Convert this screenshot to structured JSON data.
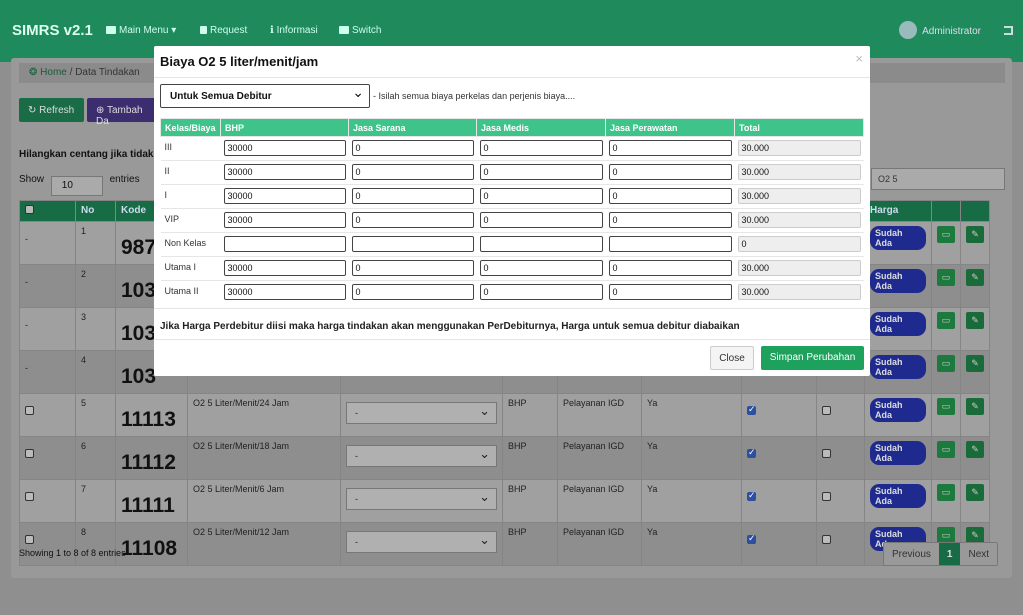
{
  "app": {
    "brand": "SIMRS v2.1",
    "nav": [
      {
        "label": "Main Menu ▾",
        "icon": "folder-icon"
      },
      {
        "label": "Request",
        "icon": "file-icon"
      },
      {
        "label": "Informasi",
        "icon": "info-icon"
      },
      {
        "label": "Switch",
        "icon": "users-icon"
      }
    ],
    "user": "Administrator"
  },
  "breadcrumb": {
    "home": "Home",
    "current": "Data Tindakan"
  },
  "toolbar": {
    "refresh": "Refresh",
    "add": "Tambah Da"
  },
  "hint": "Hilangkan centang jika tidak a",
  "show": {
    "prefix": "Show",
    "value": "10",
    "suffix": "entries"
  },
  "search_value": "O2 5",
  "table": {
    "headers": [
      "",
      "No",
      "Kode",
      "",
      "",
      "",
      "",
      "",
      "",
      "",
      "Harga",
      "",
      ""
    ],
    "rows": [
      {
        "cb": "-",
        "no": "1",
        "code": "987",
        "name": "",
        "dd": "",
        "type": "",
        "unit": "",
        "ya": "",
        "c1": null,
        "c2": null,
        "status": "Sudah Ada"
      },
      {
        "cb": "-",
        "no": "2",
        "code": "103",
        "name": "",
        "dd": "",
        "type": "",
        "unit": "",
        "ya": "",
        "c1": null,
        "c2": null,
        "status": "Sudah Ada"
      },
      {
        "cb": "-",
        "no": "3",
        "code": "103",
        "name": "",
        "dd": "",
        "type": "",
        "unit": "",
        "ya": "",
        "c1": null,
        "c2": null,
        "status": "Sudah Ada"
      },
      {
        "cb": "-",
        "no": "4",
        "code": "103",
        "name": "",
        "dd": "",
        "type": "",
        "unit": "",
        "ya": "",
        "c1": null,
        "c2": null,
        "status": "Sudah Ada"
      },
      {
        "cb": "box",
        "no": "5",
        "code": "11113",
        "name": "O2 5 Liter/Menit/24 Jam",
        "dd": "-",
        "type": "BHP",
        "unit": "Pelayanan IGD",
        "ya": "Ya",
        "c1": true,
        "c2": false,
        "status": "Sudah Ada"
      },
      {
        "cb": "box",
        "no": "6",
        "code": "11112",
        "name": "O2 5 Liter/Menit/18 Jam",
        "dd": "-",
        "type": "BHP",
        "unit": "Pelayanan IGD",
        "ya": "Ya",
        "c1": true,
        "c2": false,
        "status": "Sudah Ada"
      },
      {
        "cb": "box",
        "no": "7",
        "code": "11111",
        "name": "O2 5 Liter/Menit/6 Jam",
        "dd": "-",
        "type": "BHP",
        "unit": "Pelayanan IGD",
        "ya": "Ya",
        "c1": true,
        "c2": false,
        "status": "Sudah Ada"
      },
      {
        "cb": "box",
        "no": "8",
        "code": "11108",
        "name": "O2 5 Liter/Menit/12 Jam",
        "dd": "-",
        "type": "BHP",
        "unit": "Pelayanan IGD",
        "ya": "Ya",
        "c1": true,
        "c2": false,
        "status": "Sudah Ada"
      }
    ]
  },
  "footer": {
    "showing": "Showing 1 to 8 of 8 entries",
    "prev": "Previous",
    "page": "1",
    "next": "Next"
  },
  "modal": {
    "title": "Biaya O2 5 liter/menit/jam",
    "close_symbol": "×",
    "debitur": "Untuk Semua Debitur",
    "debitur_note": "- Isilah semua biaya perkelas dan perjenis biaya....",
    "headers": [
      "Kelas/Biaya",
      "BHP",
      "Jasa Sarana",
      "Jasa Medis",
      "Jasa Perawatan",
      "Total"
    ],
    "rows": [
      {
        "kelas": "III",
        "bhp": "30000",
        "sarana": "0",
        "medis": "0",
        "perawatan": "0",
        "total": "30.000"
      },
      {
        "kelas": "II",
        "bhp": "30000",
        "sarana": "0",
        "medis": "0",
        "perawatan": "0",
        "total": "30.000"
      },
      {
        "kelas": "I",
        "bhp": "30000",
        "sarana": "0",
        "medis": "0",
        "perawatan": "0",
        "total": "30.000"
      },
      {
        "kelas": "VIP",
        "bhp": "30000",
        "sarana": "0",
        "medis": "0",
        "perawatan": "0",
        "total": "30.000"
      },
      {
        "kelas": "Non Kelas",
        "bhp": "",
        "sarana": "",
        "medis": "",
        "perawatan": "",
        "total": "0"
      },
      {
        "kelas": "Utama I",
        "bhp": "30000",
        "sarana": "0",
        "medis": "0",
        "perawatan": "0",
        "total": "30.000"
      },
      {
        "kelas": "Utama II",
        "bhp": "30000",
        "sarana": "0",
        "medis": "0",
        "perawatan": "0",
        "total": "30.000"
      }
    ],
    "note": "Jika Harga Perdebitur diisi maka harga tindakan akan menggunakan PerDebiturnya, Harga untuk semua debitur diabaikan",
    "btn_close": "Close",
    "btn_save": "Simpan Perubahan"
  }
}
